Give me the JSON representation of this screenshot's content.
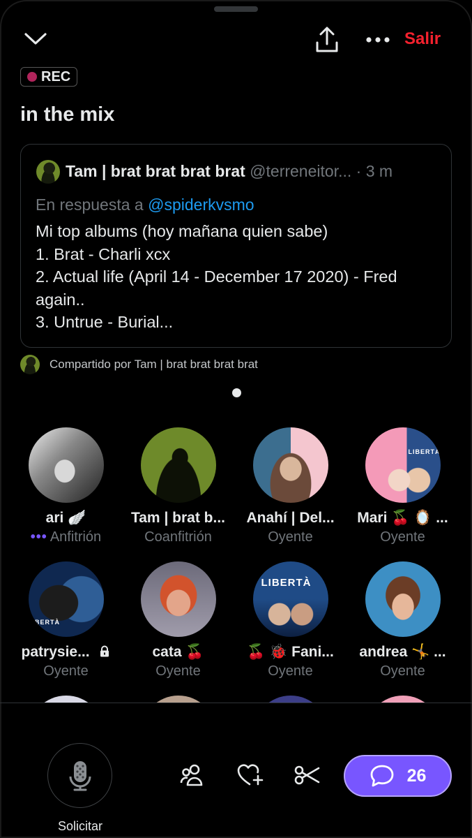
{
  "header": {
    "exit_label": "Salir"
  },
  "space": {
    "rec_label": "REC",
    "title": "in the mix"
  },
  "post": {
    "author_name": "Tam | brat brat brat brat",
    "author_handle": "@terreneitor...",
    "time": "· 3 m",
    "reply_prefix": "En respuesta a",
    "reply_mention": "@spiderkvsmo",
    "lines": [
      "Mi top albums (hoy mañana quien sabe)",
      "1. Brat - Charli xcx",
      "2. Actual life (April 14 - December 17 2020) - Fred",
      "again..",
      "3. Untrue - Burial..."
    ],
    "shared_by": "Compartido por Tam | brat brat brat brat"
  },
  "participants": [
    {
      "name": "ari 🪽",
      "role": "Anfitrión"
    },
    {
      "name": "Tam | brat b...",
      "role": "Coanfitrión"
    },
    {
      "name": "Anahí | Del...",
      "role": "Oyente"
    },
    {
      "name": "Mari 🍒 🪞 ...",
      "role": "Oyente"
    },
    {
      "name": "patrysie...",
      "role": "Oyente"
    },
    {
      "name": "cata 🍒",
      "role": "Oyente"
    },
    {
      "name": "🍒 🐞 Fani...",
      "role": "Oyente"
    },
    {
      "name": "andrea 🤸 ...",
      "role": "Oyente"
    }
  ],
  "avatar_text": {
    "liberta": "LIBERTÀ",
    "liberta_short": "IBERTÀ"
  },
  "bottom": {
    "request_label": "Solicitar",
    "comments_count": "26"
  },
  "colors": {
    "accent": "#7856ff",
    "exit": "#f4212e",
    "mention": "#1d9bf0",
    "rec_dot": "#b0245b"
  },
  "icons": [
    "chevron-down-icon",
    "share-icon",
    "more-icon",
    "microphone-icon",
    "people-icon",
    "heart-plus-icon",
    "scissors-icon",
    "chat-bubble-icon",
    "lock-icon"
  ]
}
